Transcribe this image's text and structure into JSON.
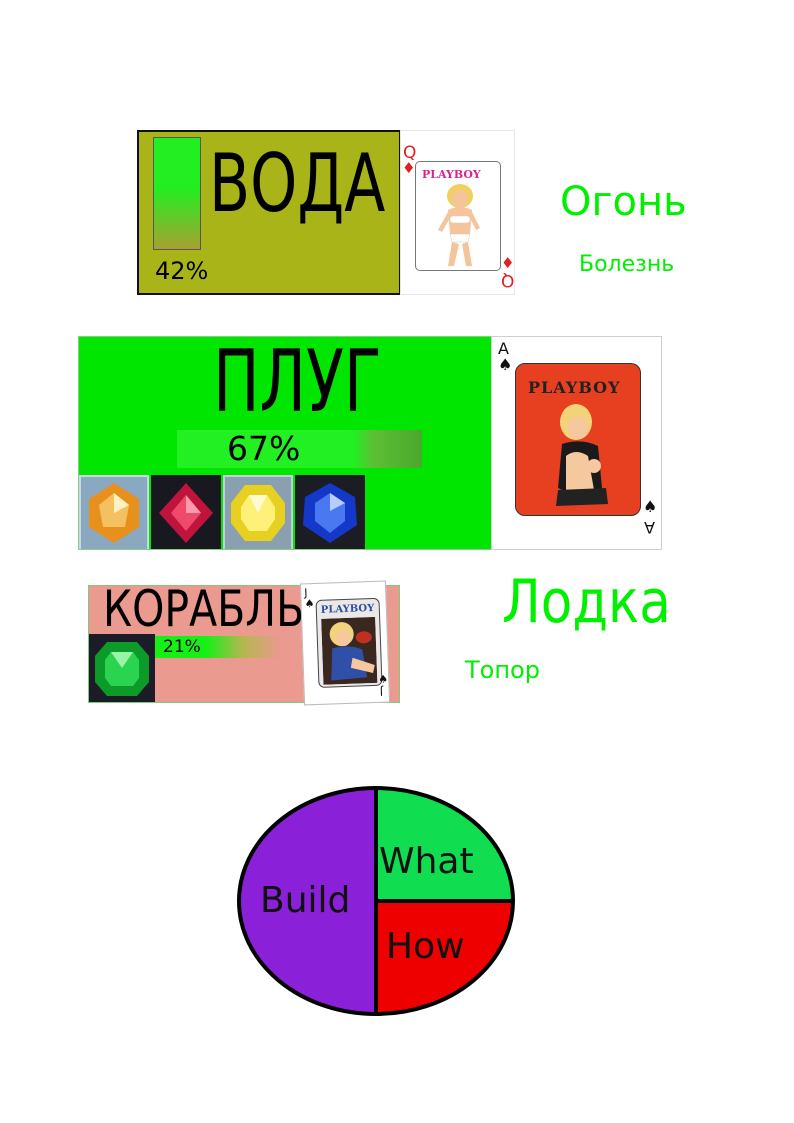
{
  "panels": [
    {
      "title": "ВОДА",
      "progress_label": "42%",
      "progress": 0.42,
      "background": "#a8b418",
      "card": {
        "rank": "Q",
        "suit_symbol": "♦",
        "suit_color": "#e02020",
        "brand": "PLAYBOY",
        "brand_color": "#e0208a"
      }
    },
    {
      "title": "ПЛУГ",
      "progress_label": "67%",
      "progress": 0.67,
      "background": "#00e600",
      "card": {
        "rank": "A",
        "suit_symbol": "♠",
        "suit_color": "#111111",
        "brand": "PLAYBOY",
        "brand_color": "#222222"
      },
      "gems": [
        "orange-gem-icon",
        "red-gem-icon",
        "yellow-gem-icon",
        "blue-gem-icon"
      ]
    },
    {
      "title": "КОРАБЛЬ",
      "progress_label": "21%",
      "progress": 0.21,
      "background": "#ea9a8e",
      "card": {
        "rank": "J",
        "suit_symbol": "♠",
        "suit_color": "#111111",
        "brand": "PLAYBOY",
        "brand_color": "#2850a0"
      },
      "gems": [
        "green-gem-icon"
      ]
    }
  ],
  "words": [
    "Огонь",
    "Болезнь",
    "Лодка",
    "Топор"
  ],
  "pie": {
    "slices": [
      {
        "label": "Build",
        "color": "#8a20d8"
      },
      {
        "label": "What",
        "color": "#10dd50"
      },
      {
        "label": "How",
        "color": "#ee0000"
      }
    ]
  },
  "colors": {
    "word_green": "#00f000",
    "pie_outline": "#000000"
  }
}
